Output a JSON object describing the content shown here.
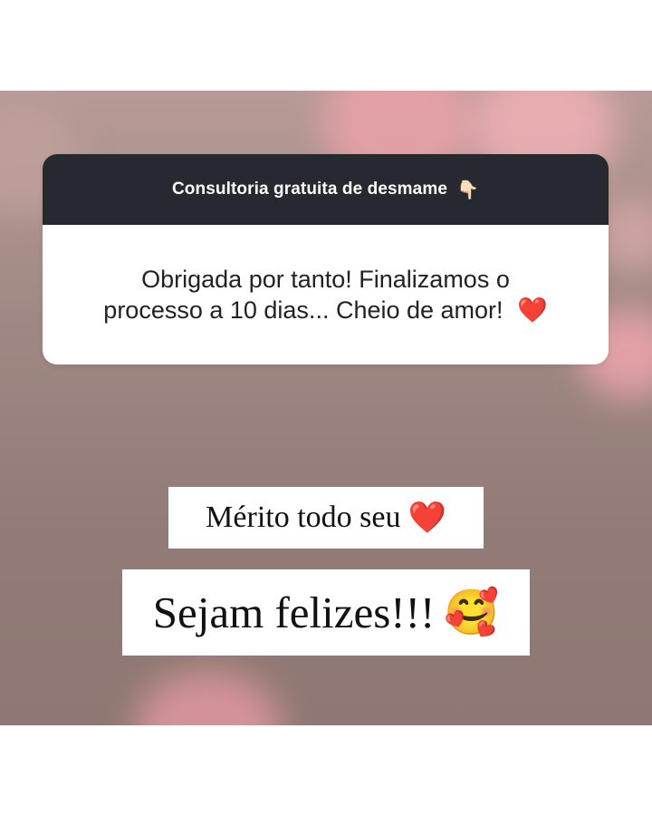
{
  "question_card": {
    "header": "Consultoria gratuita de desmame",
    "header_emoji": "👇🏻",
    "body_line1": "Obrigada por tanto! Finalizamos o",
    "body_line2": "processo a 10 dias... Cheio de amor!",
    "body_emoji": "❤️"
  },
  "replies": {
    "line1_text": "Mérito todo seu",
    "line1_emoji": "❤️",
    "line2_text": "Sejam felizes!!!",
    "line2_emoji": "🥰"
  },
  "colors": {
    "header_bg": "#262a30",
    "background_tone": "#a08984",
    "heart_red": "#d11a2a"
  }
}
